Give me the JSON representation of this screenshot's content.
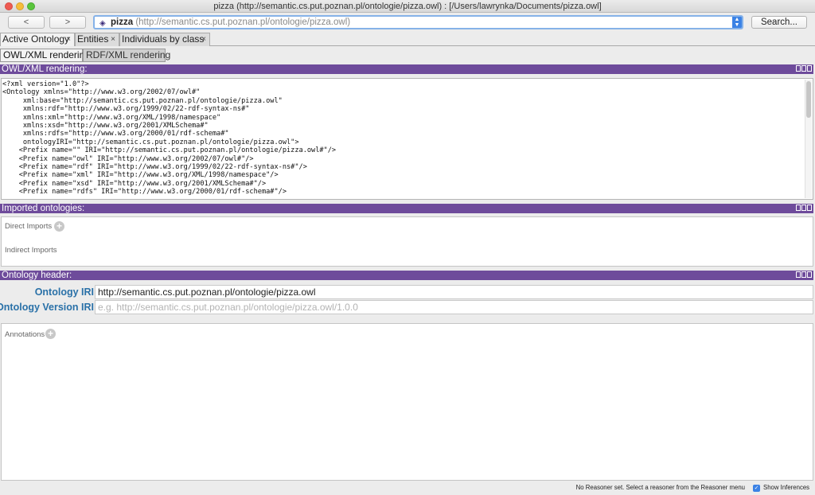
{
  "window": {
    "title": "pizza (http://semantic.cs.put.poznan.pl/ontologie/pizza.owl)  : [/Users/lawrynka/Documents/pizza.owl]"
  },
  "toolbar": {
    "back_label": "<",
    "forward_label": ">",
    "ontology_name": "pizza",
    "ontology_iri": "(http://semantic.cs.put.poznan.pl/ontologie/pizza.owl)",
    "search_label": "Search..."
  },
  "tabs": [
    {
      "label": "Active Ontology",
      "close": "×"
    },
    {
      "label": "Entities",
      "close": "×"
    },
    {
      "label": "Individuals by class",
      "close": "×"
    }
  ],
  "subtabs": [
    {
      "label": "OWL/XML rendering"
    },
    {
      "label": "RDF/XML rendering"
    }
  ],
  "owl_panel": {
    "title": "OWL/XML rendering:",
    "lines": [
      "<?xml version=\"1.0\"?>",
      "<Ontology xmlns=\"http://www.w3.org/2002/07/owl#\"",
      "     xml:base=\"http://semantic.cs.put.poznan.pl/ontologie/pizza.owl\"",
      "     xmlns:rdf=\"http://www.w3.org/1999/02/22-rdf-syntax-ns#\"",
      "     xmlns:xml=\"http://www.w3.org/XML/1998/namespace\"",
      "     xmlns:xsd=\"http://www.w3.org/2001/XMLSchema#\"",
      "     xmlns:rdfs=\"http://www.w3.org/2000/01/rdf-schema#\"",
      "     ontologyIRI=\"http://semantic.cs.put.poznan.pl/ontologie/pizza.owl\">",
      "    <Prefix name=\"\" IRI=\"http://semantic.cs.put.poznan.pl/ontologie/pizza.owl#\"/>",
      "    <Prefix name=\"owl\" IRI=\"http://www.w3.org/2002/07/owl#\"/>",
      "    <Prefix name=\"rdf\" IRI=\"http://www.w3.org/1999/02/22-rdf-syntax-ns#\"/>",
      "    <Prefix name=\"xml\" IRI=\"http://www.w3.org/XML/1998/namespace\"/>",
      "    <Prefix name=\"xsd\" IRI=\"http://www.w3.org/2001/XMLSchema#\"/>",
      "    <Prefix name=\"rdfs\" IRI=\"http://www.w3.org/2000/01/rdf-schema#\"/>"
    ]
  },
  "imports_panel": {
    "title": "Imported ontologies:",
    "direct_label": "Direct Imports",
    "indirect_label": "Indirect Imports"
  },
  "header_panel": {
    "title": "Ontology header:",
    "iri_label": "Ontology IRI",
    "iri_value": "http://semantic.cs.put.poznan.pl/ontologie/pizza.owl",
    "version_label": "Ontology Version IRI",
    "version_placeholder": "e.g. http://semantic.cs.put.poznan.pl/ontologie/pizza.owl/1.0.0",
    "annotations_label": "Annotations"
  },
  "status": {
    "message": "No Reasoner set. Select a reasoner from the Reasoner menu",
    "show_inferences_label": "Show Inferences"
  },
  "colors": {
    "panel_header": "#6e4b9b",
    "label_blue": "#2a71a8",
    "focus_ring": "#86b2e8"
  }
}
